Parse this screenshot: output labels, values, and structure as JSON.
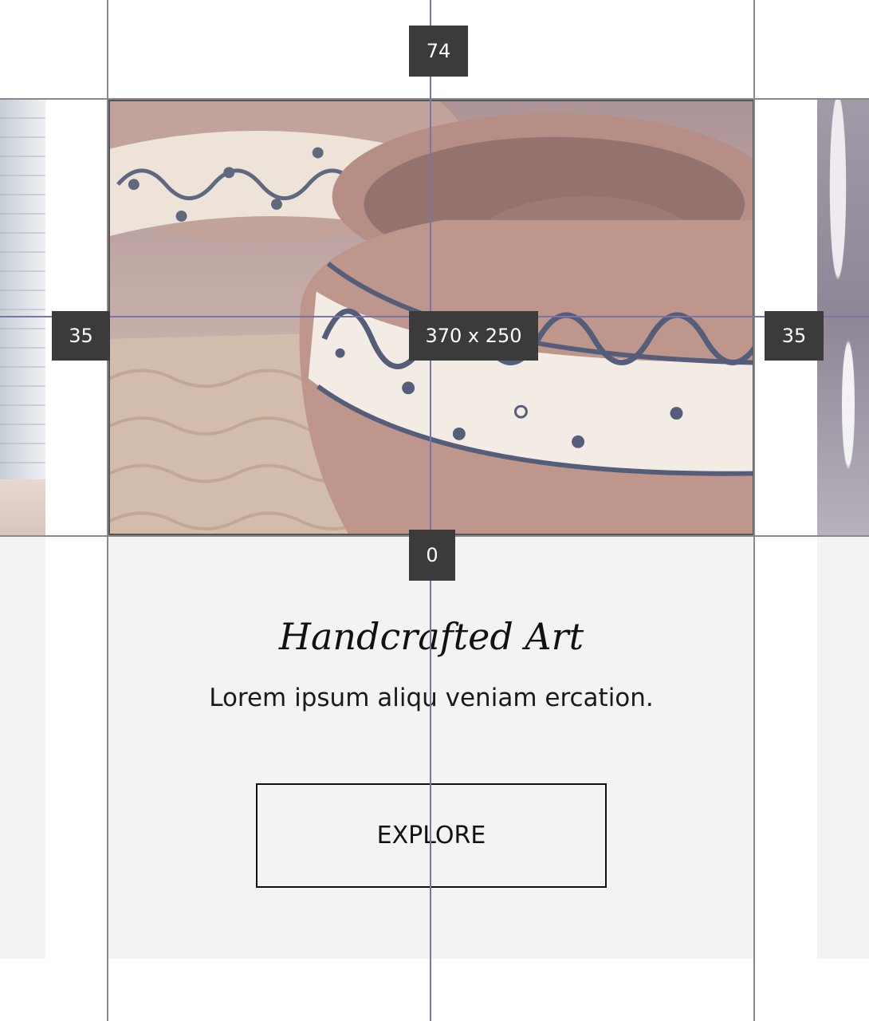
{
  "card": {
    "title": "Handcrafted Art",
    "text": "Lorem ipsum aliqu veniam ercation.",
    "button_label": "EXPLORE"
  },
  "measurements": {
    "top_spacing": "74",
    "left_spacing": "35",
    "right_spacing": "35",
    "image_size": "370 x 250",
    "bottom_spacing": "0"
  },
  "colors": {
    "card_background": "#f3f3f3",
    "badge_background": "#3b3b3b",
    "guide_line": "#888888",
    "axis_line": "#7b74a8"
  }
}
